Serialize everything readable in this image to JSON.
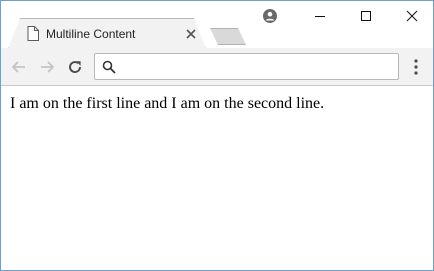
{
  "browser": {
    "tab": {
      "title": "Multiline Content",
      "icon": "page-icon",
      "close_icon": "close-icon"
    },
    "new_tab_icon": "new-tab-icon",
    "profile_icon": "profile-icon",
    "window_controls": [
      "minimize-icon",
      "maximize-icon",
      "close-icon"
    ],
    "toolbar": {
      "back_icon": "back-arrow-icon",
      "forward_icon": "forward-arrow-icon",
      "reload_icon": "reload-icon",
      "search_icon": "search-icon",
      "address_value": "",
      "menu_icon": "kebab-menu-icon"
    }
  },
  "page": {
    "text": "I am on the first line and I am on the second line."
  },
  "colors": {
    "window_border": "#6d9fd0",
    "tab_background": "#f2f2f2",
    "toolbar_background": "#f2f2f2",
    "disabled_icon": "#c4c4c4",
    "icon": "#5a5a5a"
  }
}
